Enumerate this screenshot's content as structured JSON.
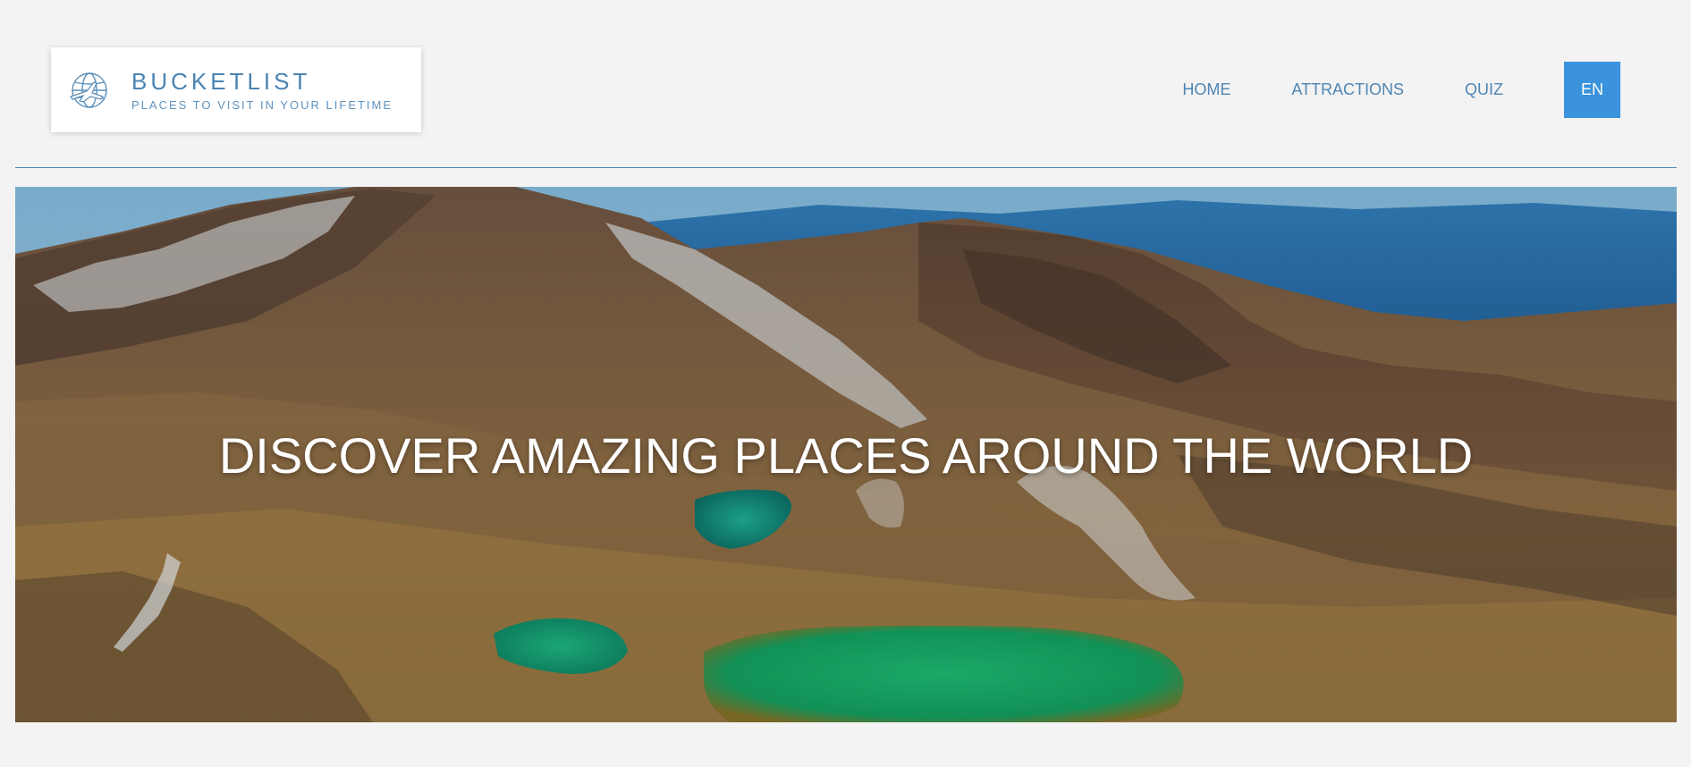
{
  "brand": {
    "title": "BUCKETLIST",
    "subtitle": "PLACES TO VISIT IN YOUR LIFETIME",
    "icon": "globe-airplane-icon"
  },
  "nav": {
    "items": [
      {
        "label": "HOME"
      },
      {
        "label": "ATTRACTIONS"
      },
      {
        "label": "QUIZ"
      }
    ],
    "language": "EN"
  },
  "hero": {
    "heading": "DISCOVER AMAZING PLACES AROUND THE WORLD",
    "image": "volcanic-mountains-emerald-lakes"
  },
  "colors": {
    "background": "#f3f3f3",
    "brand_blue": "#4a84b3",
    "accent_button": "#3a93dc",
    "divider": "#4f86b4"
  }
}
